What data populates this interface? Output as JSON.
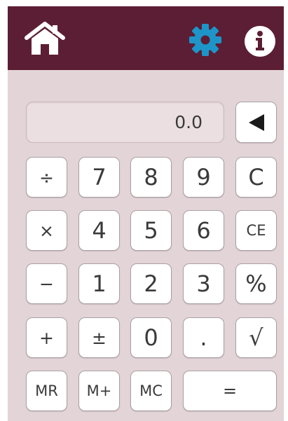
{
  "header": {
    "home_icon": "home-icon",
    "settings_icon": "gear-icon",
    "info_icon": "info-icon",
    "bar_color": "#5c1e34",
    "settings_color": "#1e95c8"
  },
  "display": {
    "value": "0.0"
  },
  "backspace_icon": "backspace-icon",
  "keypad": {
    "divide": "÷",
    "seven": "7",
    "eight": "8",
    "nine": "9",
    "clear": "C",
    "multiply": "×",
    "four": "4",
    "five": "5",
    "six": "6",
    "clear_entry": "CE",
    "subtract": "−",
    "one": "1",
    "two": "2",
    "three": "3",
    "percent": "%",
    "add": "+",
    "plus_minus": "±",
    "zero": "0",
    "decimal": ".",
    "sqrt": "√",
    "memory_recall": "MR",
    "memory_add": "M+",
    "memory_clear": "MC",
    "equals": "="
  }
}
